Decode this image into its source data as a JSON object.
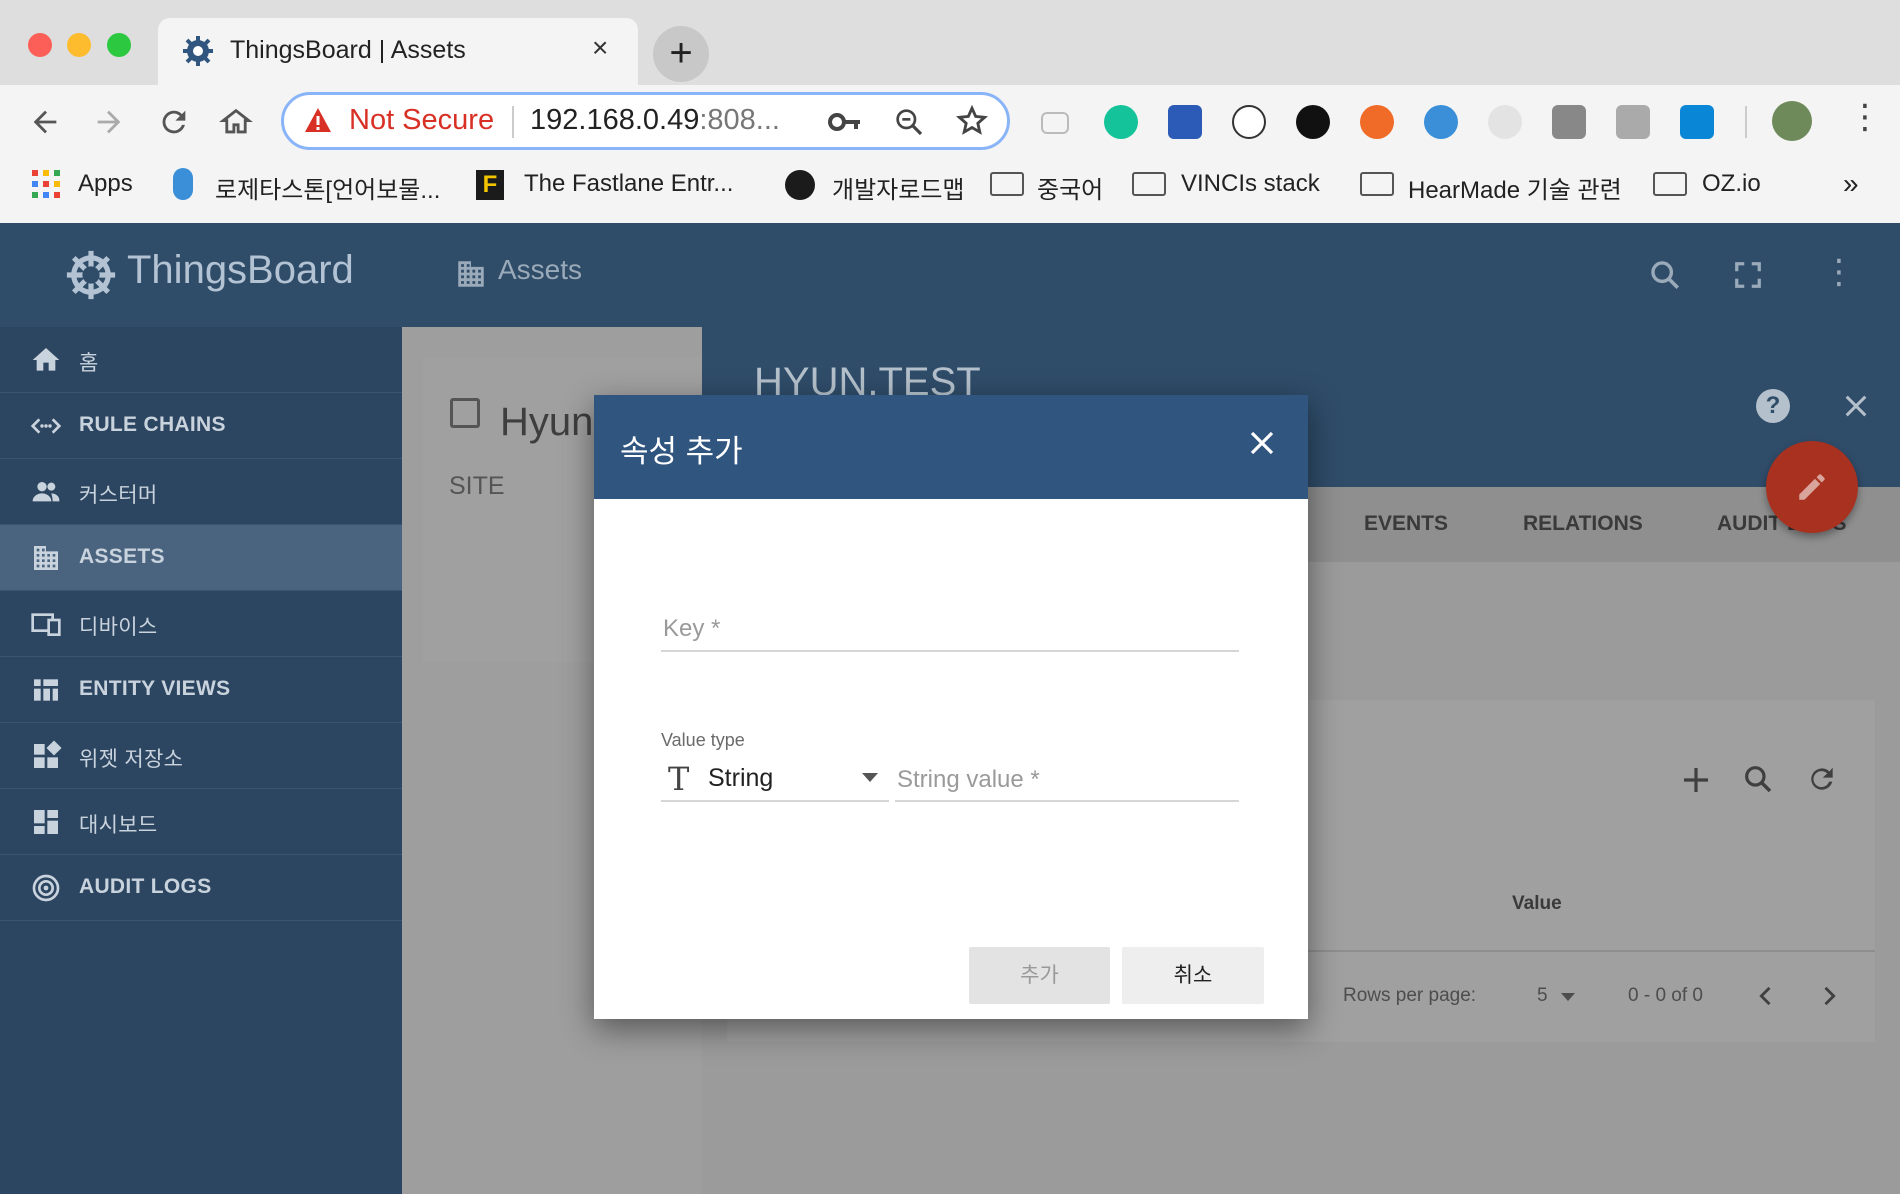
{
  "browser": {
    "tab_title": "ThingsBoard | Assets",
    "tab_close": "×",
    "new_tab": "+",
    "security_label": "Not Secure",
    "url_host": "192.168.0.49",
    "url_rest": ":808...",
    "bookmarks": [
      {
        "label": "Apps"
      },
      {
        "label": "로제타스톤[언어보물..."
      },
      {
        "label": "The Fastlane Entr..."
      },
      {
        "label": "개발자로드맵"
      },
      {
        "label": "중국어"
      },
      {
        "label": "VINCIs stack"
      },
      {
        "label": "HearMade 기술 관련"
      },
      {
        "label": "OZ.io"
      }
    ],
    "bookmarks_overflow": "»"
  },
  "app": {
    "logo_text": "ThingsBoard",
    "page_title": "Assets",
    "sidebar": {
      "items": [
        {
          "label": "홈",
          "icon": "home-icon"
        },
        {
          "label": "RULE CHAINS",
          "icon": "rule-chains-icon"
        },
        {
          "label": "커스터머",
          "icon": "customers-icon"
        },
        {
          "label": "ASSETS",
          "icon": "assets-icon"
        },
        {
          "label": "디바이스",
          "icon": "devices-icon"
        },
        {
          "label": "ENTITY VIEWS",
          "icon": "entity-views-icon"
        },
        {
          "label": "위젯 저장소",
          "icon": "widgets-icon"
        },
        {
          "label": "대시보드",
          "icon": "dashboards-icon"
        },
        {
          "label": "AUDIT LOGS",
          "icon": "audit-logs-icon"
        }
      ]
    },
    "asset_card": {
      "title": "Hyun",
      "subtitle": "SITE"
    },
    "detail": {
      "title": "HYUN.TEST",
      "tabs": [
        "EVENTS",
        "RELATIONS",
        "AUDIT LOGS"
      ],
      "table_header_value": "Value",
      "rows_per_page_label": "Rows per page:",
      "rows_per_page_value": "5",
      "range": "0 - 0 of 0"
    }
  },
  "dialog": {
    "title": "속성 추가",
    "key_placeholder": "Key *",
    "value_type_label": "Value type",
    "value_type_icon": "T",
    "value_type_value": "String",
    "string_value_placeholder": "String value *",
    "add_label": "추가",
    "cancel_label": "취소"
  },
  "colors": {
    "sidebar": "#2c4560",
    "header": "#2f4c69",
    "dialog_header": "#305680",
    "fab": "#a8321f",
    "not_secure": "#d93025"
  }
}
